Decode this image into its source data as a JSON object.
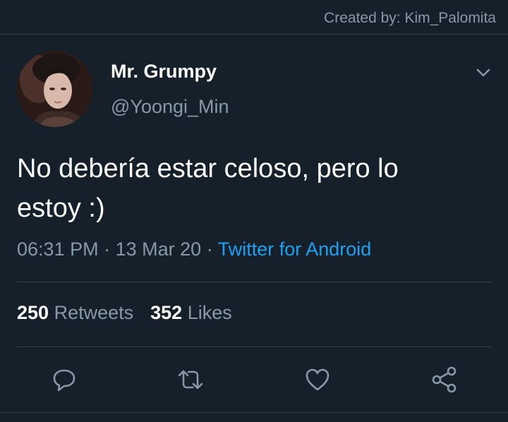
{
  "credit": "Created by: Kim_Palomita",
  "tweet": {
    "display_name": "Mr. Grumpy",
    "handle": "@Yoongi_Min",
    "text_line1": "No debería estar celoso, pero lo",
    "text_line2": "estoy :)",
    "time": "06:31 PM",
    "date": "13 Mar 20",
    "separator": "·",
    "source": "Twitter for Android"
  },
  "stats": {
    "retweets_count": "250",
    "retweets_label": "Retweets",
    "likes_count": "352",
    "likes_label": "Likes"
  },
  "icons": {
    "menu": "chevron-down-icon",
    "reply": "reply-icon",
    "retweet": "retweet-icon",
    "like": "heart-icon",
    "share": "share-icon"
  },
  "colors": {
    "background": "#15202b",
    "text": "#ffffff",
    "muted": "#8899a6",
    "link": "#1da1f2",
    "divider": "#38444d"
  }
}
